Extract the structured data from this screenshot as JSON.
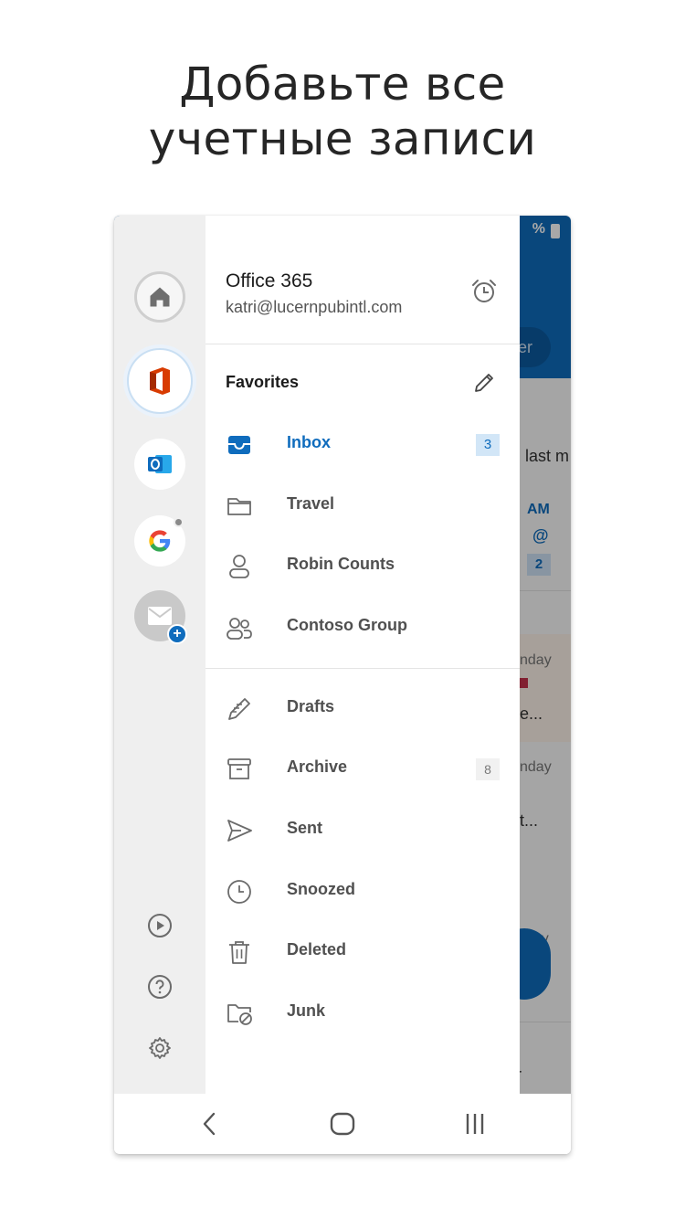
{
  "headline": {
    "line1": "Добавьте все",
    "line2": "учетные записи"
  },
  "background_app": {
    "status": "%",
    "pill_text": "er",
    "preview": "last m",
    "time": "AM",
    "at": "@",
    "badge": "2",
    "day1": "nday",
    "snippet1": "e...",
    "day2": "nday",
    "snippet2": "t...",
    "day3": "day",
    "last": "r"
  },
  "account": {
    "name": "Office 365",
    "email": "katri@lucernpubintl.com"
  },
  "rail": {
    "accounts": [
      "home-icon",
      "office-icon",
      "outlook-icon",
      "google-icon",
      "mail-icon"
    ],
    "bottom_icons": [
      "play-icon",
      "help-icon",
      "settings-icon"
    ]
  },
  "favorites": {
    "title": "Favorites",
    "items": [
      {
        "label": "Inbox",
        "count": "3",
        "icon": "inbox-icon"
      },
      {
        "label": "Travel",
        "icon": "folder-icon"
      },
      {
        "label": "Robin Counts",
        "icon": "person-icon"
      },
      {
        "label": "Contoso Group",
        "icon": "group-icon"
      }
    ]
  },
  "folders": [
    {
      "label": "Drafts",
      "icon": "drafts-icon"
    },
    {
      "label": "Archive",
      "count": "8",
      "icon": "archive-icon"
    },
    {
      "label": "Sent",
      "icon": "send-icon"
    },
    {
      "label": "Snoozed",
      "icon": "clock-icon"
    },
    {
      "label": "Deleted",
      "icon": "trash-icon"
    },
    {
      "label": "Junk",
      "icon": "junk-folder-icon"
    }
  ],
  "colors": {
    "accent": "#0f6cbd",
    "rail_bg": "#efefef",
    "badge_bg": "#d2e6f7"
  },
  "navbar": [
    "back-icon",
    "home-nav-icon",
    "recents-icon"
  ]
}
